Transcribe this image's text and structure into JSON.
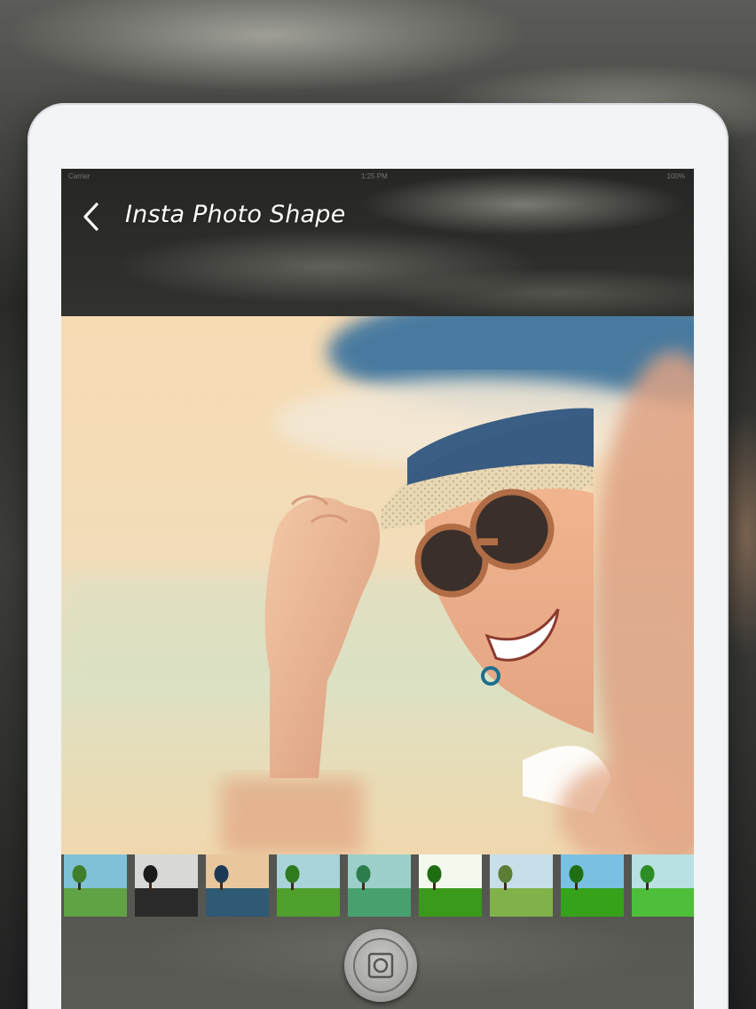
{
  "status_bar": {
    "carrier": "Carrier",
    "time": "1:25 PM",
    "battery": "100%"
  },
  "nav": {
    "title": "Insta Photo Shape",
    "back_icon": "chevron-left-icon"
  },
  "photo": {
    "description_icon": "photo-canvas"
  },
  "filters": [
    {
      "id": "filter-1",
      "sky": "#7fc2d8",
      "ground": "#5fa344",
      "tree": "#3f7f2c"
    },
    {
      "id": "filter-2",
      "sky": "#d8d8d6",
      "ground": "#2a2a2a",
      "tree": "#1b1b1b"
    },
    {
      "id": "filter-3",
      "sky": "#e8c79c",
      "ground": "#2e5a73",
      "tree": "#1d3a55"
    },
    {
      "id": "filter-4",
      "sky": "#a8d3d8",
      "ground": "#4fa02c",
      "tree": "#2f7a1e"
    },
    {
      "id": "filter-5",
      "sky": "#9ccfc9",
      "ground": "#48a06e",
      "tree": "#2c7d4d"
    },
    {
      "id": "filter-6",
      "sky": "#f4f9ee",
      "ground": "#3a9a1c",
      "tree": "#1f6d12"
    },
    {
      "id": "filter-7",
      "sky": "#c6dfe9",
      "ground": "#7fb24a",
      "tree": "#5c7d34"
    },
    {
      "id": "filter-8",
      "sky": "#7ac0e2",
      "ground": "#35a21a",
      "tree": "#1f7014"
    },
    {
      "id": "filter-9",
      "sky": "#b9e0e3",
      "ground": "#4ebf3a",
      "tree": "#2b8d24"
    }
  ],
  "capture": {
    "icon": "save-photo-icon"
  }
}
